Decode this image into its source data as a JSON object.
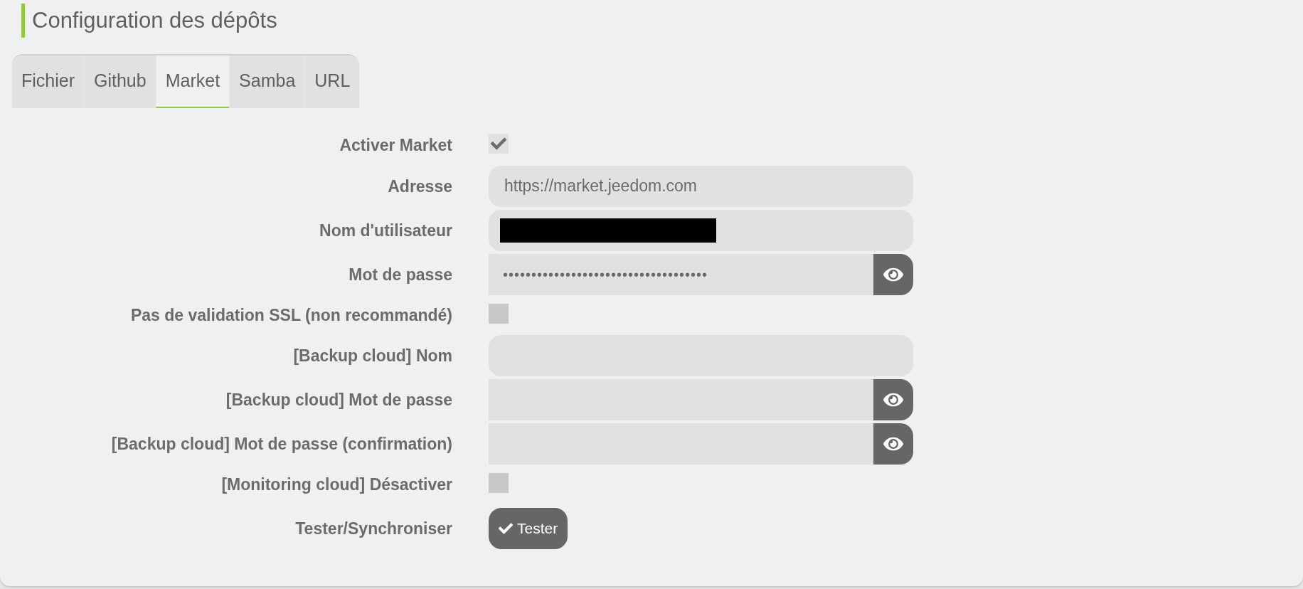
{
  "title": "Configuration des dépôts",
  "tabs": [
    {
      "label": "Fichier",
      "selected": false
    },
    {
      "label": "Github",
      "selected": false
    },
    {
      "label": "Market",
      "selected": true
    },
    {
      "label": "Samba",
      "selected": false
    },
    {
      "label": "URL",
      "selected": false
    }
  ],
  "form": [
    {
      "kind": "checkbox",
      "label": "Activer Market",
      "checked": true
    },
    {
      "kind": "text",
      "label": "Adresse",
      "value": "https://market.jeedom.com"
    },
    {
      "kind": "text",
      "label": "Nom d'utilisateur",
      "redacted": true
    },
    {
      "kind": "password",
      "label": "Mot de passe",
      "value": "••••••••••••••••••••••••••••••••••••"
    },
    {
      "kind": "checkbox",
      "label": "Pas de validation SSL (non recommandé)",
      "checked": false
    },
    {
      "kind": "text",
      "label": "[Backup cloud] Nom"
    },
    {
      "kind": "password",
      "label": "[Backup cloud] Mot de passe"
    },
    {
      "kind": "password",
      "label": "[Backup cloud] Mot de passe (confirmation)"
    },
    {
      "kind": "checkbox",
      "label": "[Monitoring cloud] Désactiver",
      "checked": false
    },
    {
      "kind": "button",
      "label": "Tester/Synchroniser",
      "button": "Tester"
    }
  ]
}
